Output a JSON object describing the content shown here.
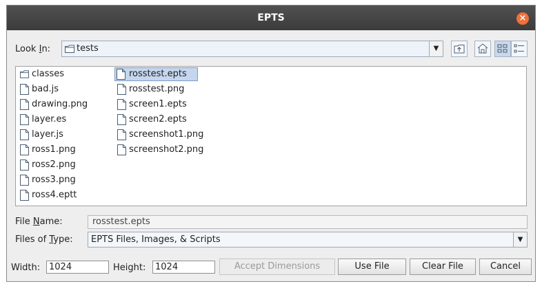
{
  "window": {
    "title": "EPTS",
    "close_symbol": "×"
  },
  "look_in": {
    "label": "Look In:",
    "value": "tests"
  },
  "files": {
    "column1": [
      "classes",
      "bad.js",
      "drawing.png",
      "layer.es",
      "layer.js",
      "ross1.png",
      "ross2.png",
      "ross3.png",
      "ross4.eptt"
    ],
    "column2": [
      "rosstest.epts",
      "rosstest.png",
      "screen1.epts",
      "screen2.epts",
      "screenshot1.png",
      "screenshot2.png"
    ],
    "selected": "rosstest.epts"
  },
  "file_name": {
    "label": "File Name:",
    "value": "rosstest.epts"
  },
  "files_of_type": {
    "label": "Files of Type:",
    "value": "EPTS Files, Images, & Scripts"
  },
  "dimensions": {
    "width_label": "Width:",
    "width_value": "1024",
    "height_label": "Height:",
    "height_value": "1024"
  },
  "buttons": {
    "accept_dimensions": "Accept Dimensions",
    "use_file": "Use File",
    "clear_file": "Clear File",
    "cancel": "Cancel"
  },
  "icons": {
    "up_folder": "up-folder-icon",
    "home": "home-icon",
    "list_view": "list-view-icon",
    "details_view": "details-view-icon"
  }
}
